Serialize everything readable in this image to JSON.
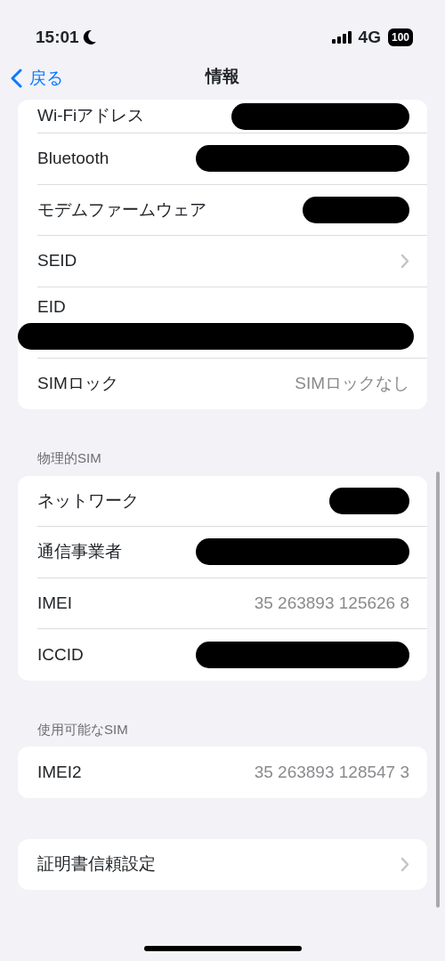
{
  "status_bar": {
    "time": "15:01",
    "network": "4G",
    "battery": "100"
  },
  "nav": {
    "back": "戻る",
    "title": "情報"
  },
  "groups": [
    {
      "rows": [
        {
          "label": "Wi-Fiアドレス",
          "kind": "redacted"
        },
        {
          "label": "Bluetooth",
          "kind": "redacted"
        },
        {
          "label": "モデムファームウェア",
          "kind": "redacted"
        },
        {
          "label": "SEID",
          "kind": "link"
        },
        {
          "label": "EID",
          "kind": "redacted_below"
        },
        {
          "label": "SIMロック",
          "kind": "value",
          "value": "SIMロックなし"
        }
      ]
    },
    {
      "header": "物理的SIM",
      "rows": [
        {
          "label": "ネットワーク",
          "kind": "redacted"
        },
        {
          "label": "通信事業者",
          "kind": "redacted"
        },
        {
          "label": "IMEI",
          "kind": "value",
          "value": "35 263893 125626 8"
        },
        {
          "label": "ICCID",
          "kind": "redacted"
        }
      ]
    },
    {
      "header": "使用可能なSIM",
      "rows": [
        {
          "label": "IMEI2",
          "kind": "value",
          "value": "35 263893 128547 3"
        }
      ]
    },
    {
      "rows": [
        {
          "label": "証明書信頼設定",
          "kind": "link"
        }
      ]
    }
  ]
}
